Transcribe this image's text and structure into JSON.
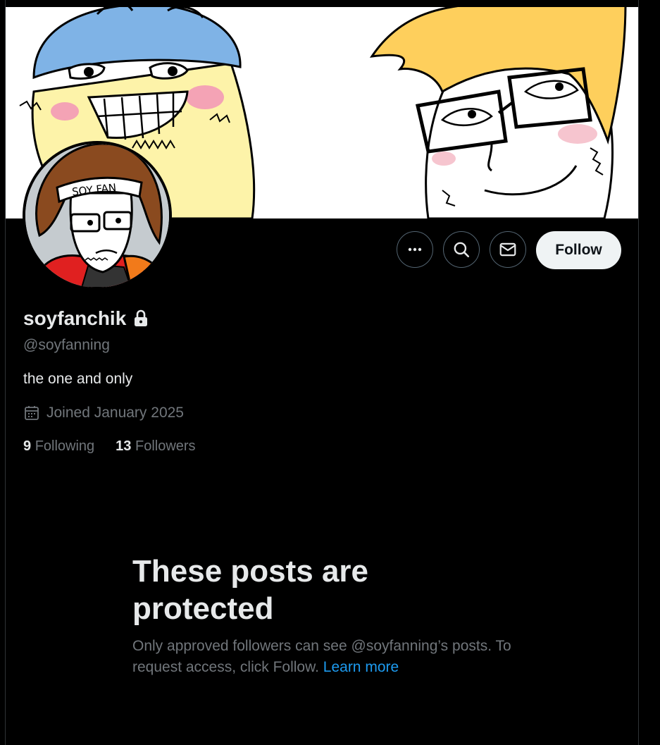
{
  "profile": {
    "display_name": "soyfanchik",
    "handle": "@soyfanning",
    "bio": "the one and only",
    "joined": "Joined January 2025",
    "following_count": "9",
    "following_label": "Following",
    "followers_count": "13",
    "followers_label": "Followers",
    "locked_icon": "lock-icon"
  },
  "avatar": {
    "headband_text": "SOY FAN"
  },
  "actions": {
    "more_icon": "more-icon",
    "search_icon": "search-icon",
    "message_icon": "mail-icon",
    "follow_label": "Follow"
  },
  "protected": {
    "title": "These posts are protected",
    "description": "Only approved followers can see @soyfanning’s posts. To request access, click Follow.",
    "learn_more": "Learn more"
  },
  "colors": {
    "background": "#000000",
    "text_primary": "#e7e9ea",
    "text_secondary": "#71767b",
    "link": "#1d9bf0",
    "follow_button_bg": "#eff3f4"
  }
}
